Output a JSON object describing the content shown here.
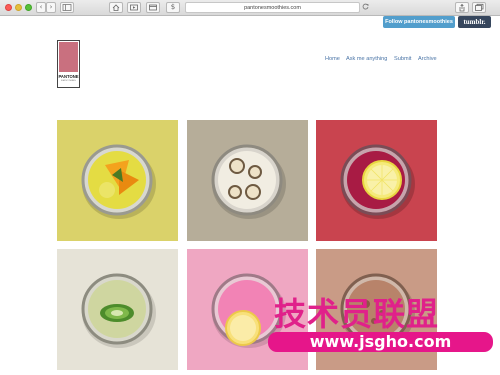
{
  "browser": {
    "url": "pantonesmoothies.com",
    "back_glyph": "‹",
    "forward_glyph": "›",
    "dollar_glyph": "$"
  },
  "tumblr_bar": {
    "follow_label": "Follow pantonesmoothies",
    "brand_label": "tumblr."
  },
  "logo": {
    "brand": "PANTONE",
    "subtitle": "SMOOTHIES",
    "swatch_color": "#c9707f"
  },
  "nav": {
    "items": [
      "Home",
      "Ask me anything",
      "Submit",
      "Archive"
    ]
  },
  "tiles": [
    {
      "background": "#dad26a",
      "drink": "yellow smoothie with mango slices"
    },
    {
      "background": "#b6ad99",
      "drink": "cream smoothie with banana slices"
    },
    {
      "background": "#c9444f",
      "drink": "red smoothie with lemon slice"
    },
    {
      "background": "#e6e3d7",
      "drink": "kiwi smoothie"
    },
    {
      "background": "#efa7c2",
      "drink": "pink smoothie with lemon slice"
    },
    {
      "background": "#c99b86",
      "drink": "chocolate smoothie"
    }
  ],
  "watermark": {
    "line1": "技术员联盟",
    "line2": "www.jsgho.com"
  }
}
